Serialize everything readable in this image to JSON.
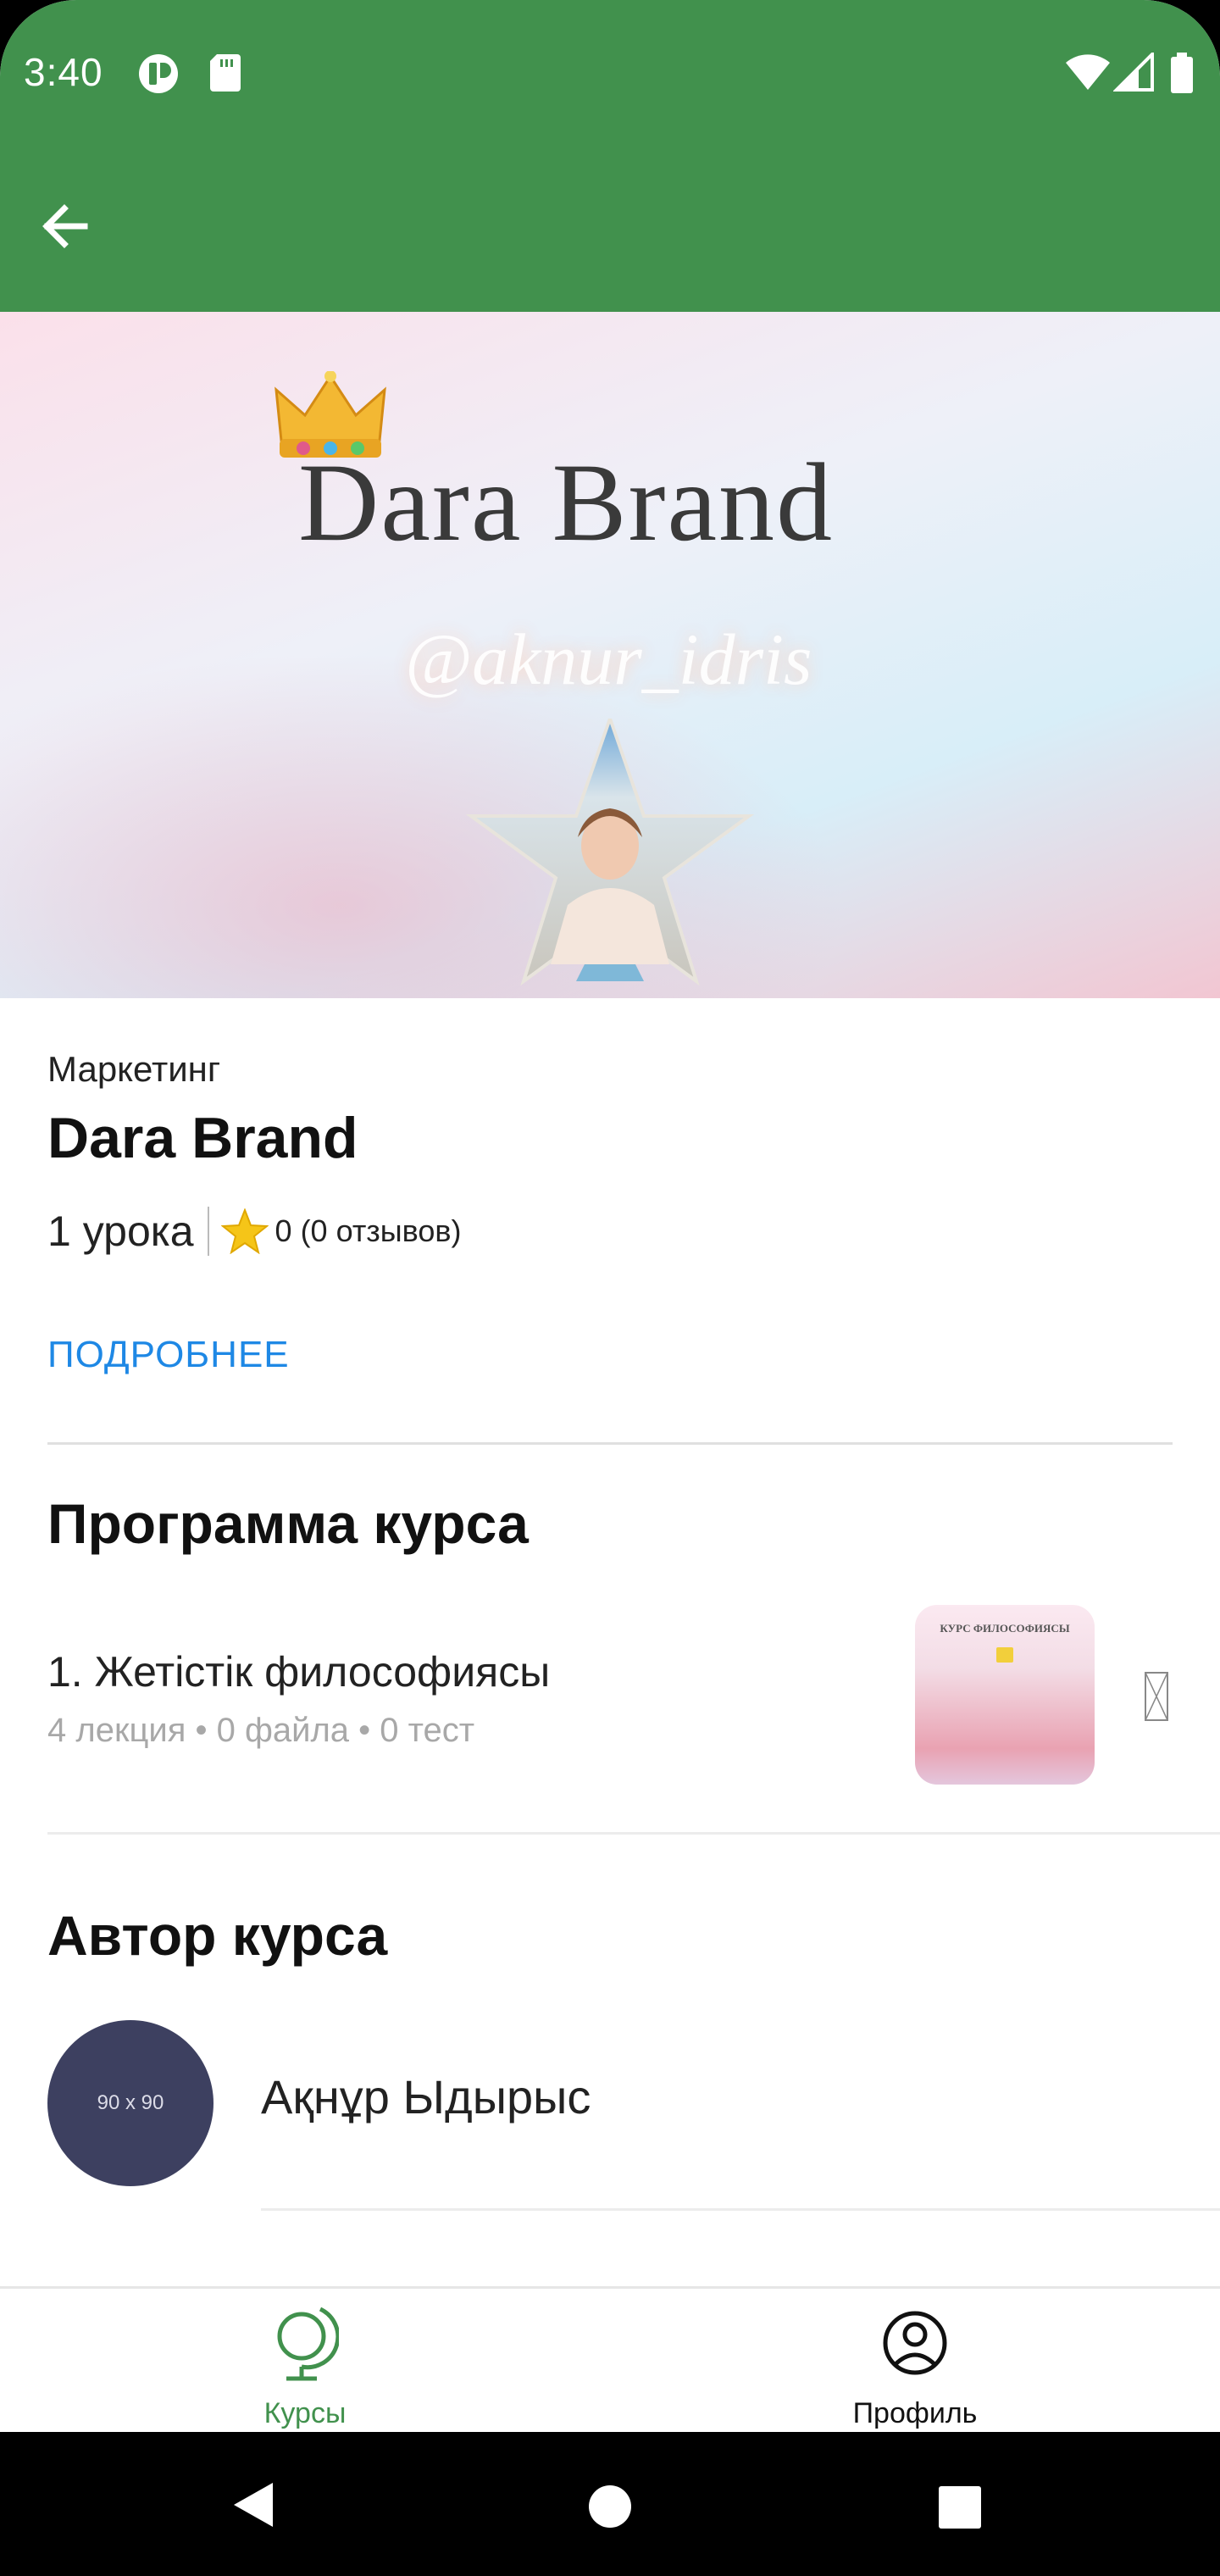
{
  "status_bar": {
    "time": "3:40",
    "icons": [
      "app-notification-icon",
      "sd-card-icon",
      "wifi-icon",
      "cell-signal-icon",
      "battery-icon"
    ]
  },
  "app_bar": {
    "back_icon": "arrow-left-icon",
    "color": "#41914d"
  },
  "banner": {
    "title": "Dara Brand",
    "handle": "@aknur_idris"
  },
  "course": {
    "category": "Маркетинг",
    "title": "Dara Brand",
    "lessons": "1 урока",
    "rating": "0 (0 отзывов)",
    "more_label": "ПОДРОБНЕЕ"
  },
  "program": {
    "section_title": "Программа курса",
    "lessons": [
      {
        "name": "1. Жетістік философиясы",
        "meta": "4 лекция • 0 файла • 0 тест",
        "thumb_text": "КУРС ФИЛОСОФИЯСЫ"
      }
    ]
  },
  "author": {
    "section_title": "Автор курса",
    "avatar_placeholder": "90 x 90",
    "name": "Ақнұр Ыдырыс"
  },
  "bottom_nav": {
    "items": [
      {
        "label": "Курсы",
        "icon": "globe-icon",
        "active": true
      },
      {
        "label": "Профиль",
        "icon": "account-circle-icon",
        "active": false
      }
    ]
  },
  "colors": {
    "primary": "#41914d",
    "link": "#1e88e5"
  }
}
